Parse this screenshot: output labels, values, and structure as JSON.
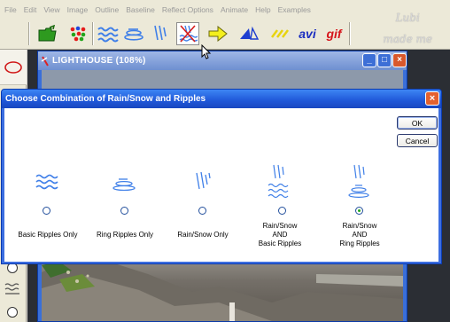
{
  "menu": [
    "File",
    "Edit",
    "View",
    "Image",
    "Outline",
    "Baseline",
    "Reflect Options",
    "Animate",
    "Help",
    "Examples"
  ],
  "toolbar": {
    "avi_label": "avi",
    "gif_label": "gif"
  },
  "watermark": {
    "line1": "Lubi",
    "line2": "made me"
  },
  "document": {
    "title": "LIGHTHOUSE   (108%)"
  },
  "dialog": {
    "title": "Choose Combination of Rain/Snow and Ripples",
    "ok_label": "OK",
    "cancel_label": "Cancel",
    "options": [
      {
        "label": "Basic Ripples Only",
        "selected": false
      },
      {
        "label": "Ring Ripples Only",
        "selected": false
      },
      {
        "label": "Rain/Snow Only",
        "selected": false
      },
      {
        "label": "Rain/Snow\nAND\nBasic Ripples",
        "selected": false
      },
      {
        "label": "Rain/Snow\nAND\nRing Ripples",
        "selected": true
      }
    ]
  },
  "colors": {
    "accent": "#1f57d8",
    "radio_selected": "#24a81a"
  }
}
